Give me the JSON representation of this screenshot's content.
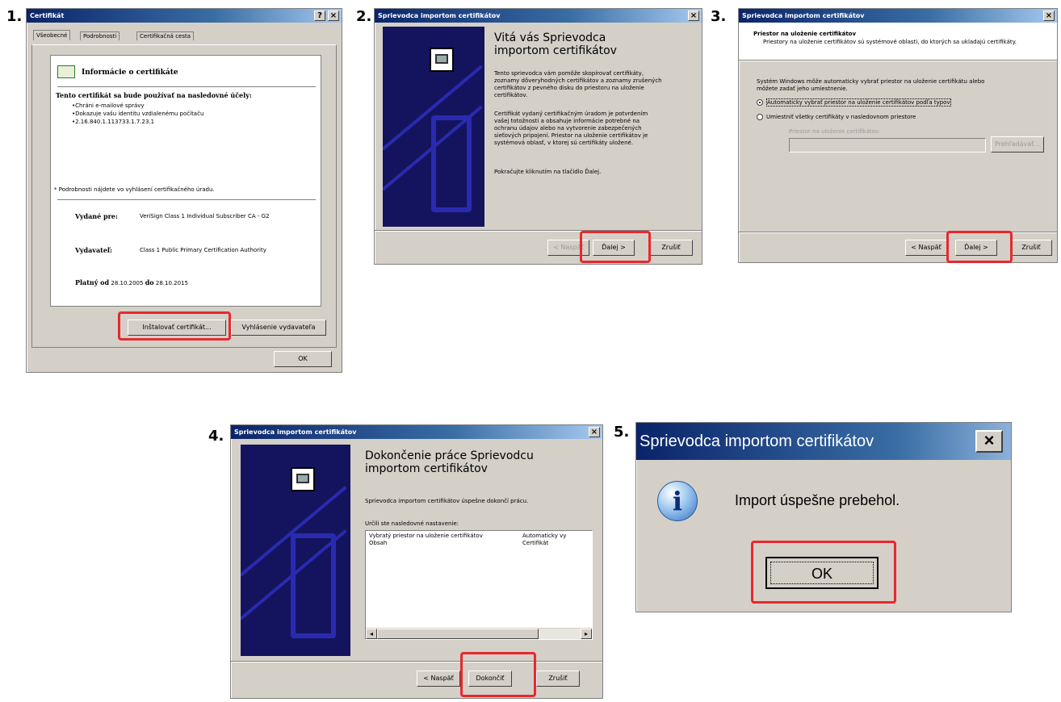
{
  "steps": [
    "1.",
    "2.",
    "3.",
    "4.",
    "5."
  ],
  "cert": {
    "title": "Certifikát",
    "tabs": [
      "Všeobecné",
      "Podrobnosti",
      "Certifikačná cesta"
    ],
    "info_title": "Informácie o certifikáte",
    "purpose_heading": "Tento certifikát sa bude používať na nasledovné účely:",
    "purposes": [
      "•Chráni e-mailové správy",
      "•Dokazuje vašu identitu vzdialenému počítaču",
      "•2.16.840.1.113733.1.7.23.1"
    ],
    "note": "* Podrobnosti nájdete vo vyhlásení certifikačného úradu.",
    "issued_to_label": "Vydané pre:",
    "issued_to_value": "VeriSign Class 1 Individual Subscriber CA - G2",
    "issuer_label": "Vydavateľ:",
    "issuer_value": "Class 1 Public Primary Certification Authority",
    "valid_from_label": "Platný od",
    "valid_from": "28.10.2005",
    "valid_to_label": "do",
    "valid_to": "28.10.2015",
    "install_btn": "Inštalovať certifikát...",
    "statement_btn": "Vyhlásenie vydavateľa",
    "ok_btn": "OK"
  },
  "wizard": {
    "title": "Sprievodca importom certifikátov",
    "welcome_title": "Vitá vás Sprievodca importom certifikátov",
    "welcome_p1": "Tento sprievodca vám pomôže skopírovať certifikáty, zoznamy dôveryhodných certifikátov a zoznamy zrušených certifikátov z pevného disku do priestoru na uloženie certifikátov.",
    "welcome_p2": "Certifikát vydaný certifikačným úradom je potvrdením vašej totožnosti a obsahuje informácie potrebné na ochranu údajov alebo na vytvorenie zabezpečených sieťových pripojení. Priestor na uloženie certifikátov je systémová oblasť, v ktorej sú certifikáty uložené.",
    "welcome_p3": "Pokračujte kliknutím na tlačidlo Ďalej.",
    "back_btn": "< Naspäť",
    "next_btn": "Ďalej >",
    "cancel_btn": "Zrušiť",
    "finish_btn": "Dokončiť",
    "store_title": "Priestor na uloženie certifikátov",
    "store_sub": "Priestory na uloženie certifikátov sú systémové oblasti, do ktorých sa ukladajú certifikáty.",
    "store_p": "Systém Windows môže automaticky vybrať priestor na uloženie certifikátu alebo môžete zadať jeho umiestnenie.",
    "radio_auto": "Automaticky vybrať priestor na uloženie certifikátov podľa typov",
    "radio_manual": "Umiestniť všetky certifikáty v nasledovnom priestore",
    "store_field_label": "Priestor na uloženie certifikátov:",
    "browse_btn": "Prehľadávať...",
    "finish_title": "Dokončenie práce Sprievodcu importom certifikátov",
    "finish_p": "Sprievodca importom certifikátov úspešne dokončí prácu.",
    "settings_label": "Určili ste nasledovné nastavenie:",
    "settings_rows": [
      [
        "Vybratý priestor na uloženie certifikátov",
        "Automaticky vy"
      ],
      [
        "Obsah",
        "Certifikát"
      ]
    ]
  },
  "msg": {
    "title": "Sprievodca importom certifikátov",
    "text": "Import úspešne prebehol.",
    "ok_btn": "OK"
  },
  "colors": {
    "highlight": "#e8282e",
    "title_blue": "#0a246a",
    "dialog_gray": "#d4d0c8"
  }
}
